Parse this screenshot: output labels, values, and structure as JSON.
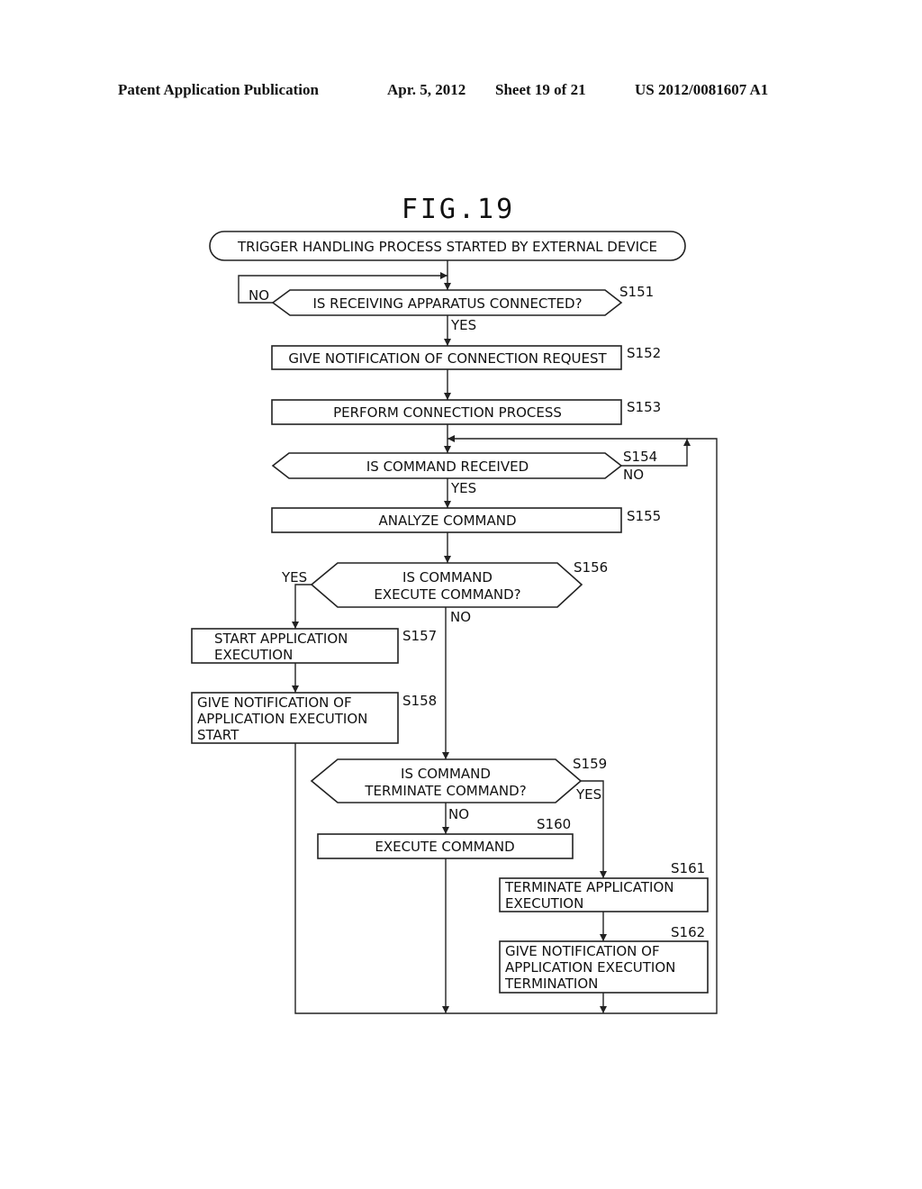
{
  "header": {
    "publication": "Patent Application Publication",
    "date": "Apr. 5, 2012",
    "sheet": "Sheet 19 of 21",
    "number": "US 2012/0081607 A1"
  },
  "figure": {
    "title": "FIG.19",
    "start": "TRIGGER HANDLING PROCESS STARTED BY EXTERNAL DEVICE",
    "steps": {
      "s151": {
        "id": "S151",
        "lines": [
          "IS RECEIVING APPARATUS CONNECTED?"
        ]
      },
      "s152": {
        "id": "S152",
        "lines": [
          "GIVE NOTIFICATION OF CONNECTION REQUEST"
        ]
      },
      "s153": {
        "id": "S153",
        "lines": [
          "PERFORM CONNECTION PROCESS"
        ]
      },
      "s154": {
        "id": "S154",
        "lines": [
          "IS COMMAND RECEIVED"
        ]
      },
      "s155": {
        "id": "S155",
        "lines": [
          "ANALYZE COMMAND"
        ]
      },
      "s156": {
        "id": "S156",
        "lines": [
          "IS COMMAND",
          "EXECUTE COMMAND?"
        ]
      },
      "s157": {
        "id": "S157",
        "lines": [
          "START APPLICATION",
          "EXECUTION"
        ]
      },
      "s158": {
        "id": "S158",
        "lines": [
          "GIVE NOTIFICATION OF",
          "APPLICATION EXECUTION",
          "START"
        ]
      },
      "s159": {
        "id": "S159",
        "lines": [
          "IS COMMAND",
          "TERMINATE COMMAND?"
        ]
      },
      "s160": {
        "id": "S160",
        "lines": [
          "EXECUTE COMMAND"
        ]
      },
      "s161": {
        "id": "S161",
        "lines": [
          "TERMINATE APPLICATION",
          "EXECUTION"
        ]
      },
      "s162": {
        "id": "S162",
        "lines": [
          "GIVE NOTIFICATION OF",
          "APPLICATION EXECUTION",
          "TERMINATION"
        ]
      }
    },
    "branch_labels": {
      "yes": "YES",
      "no": "NO"
    }
  }
}
